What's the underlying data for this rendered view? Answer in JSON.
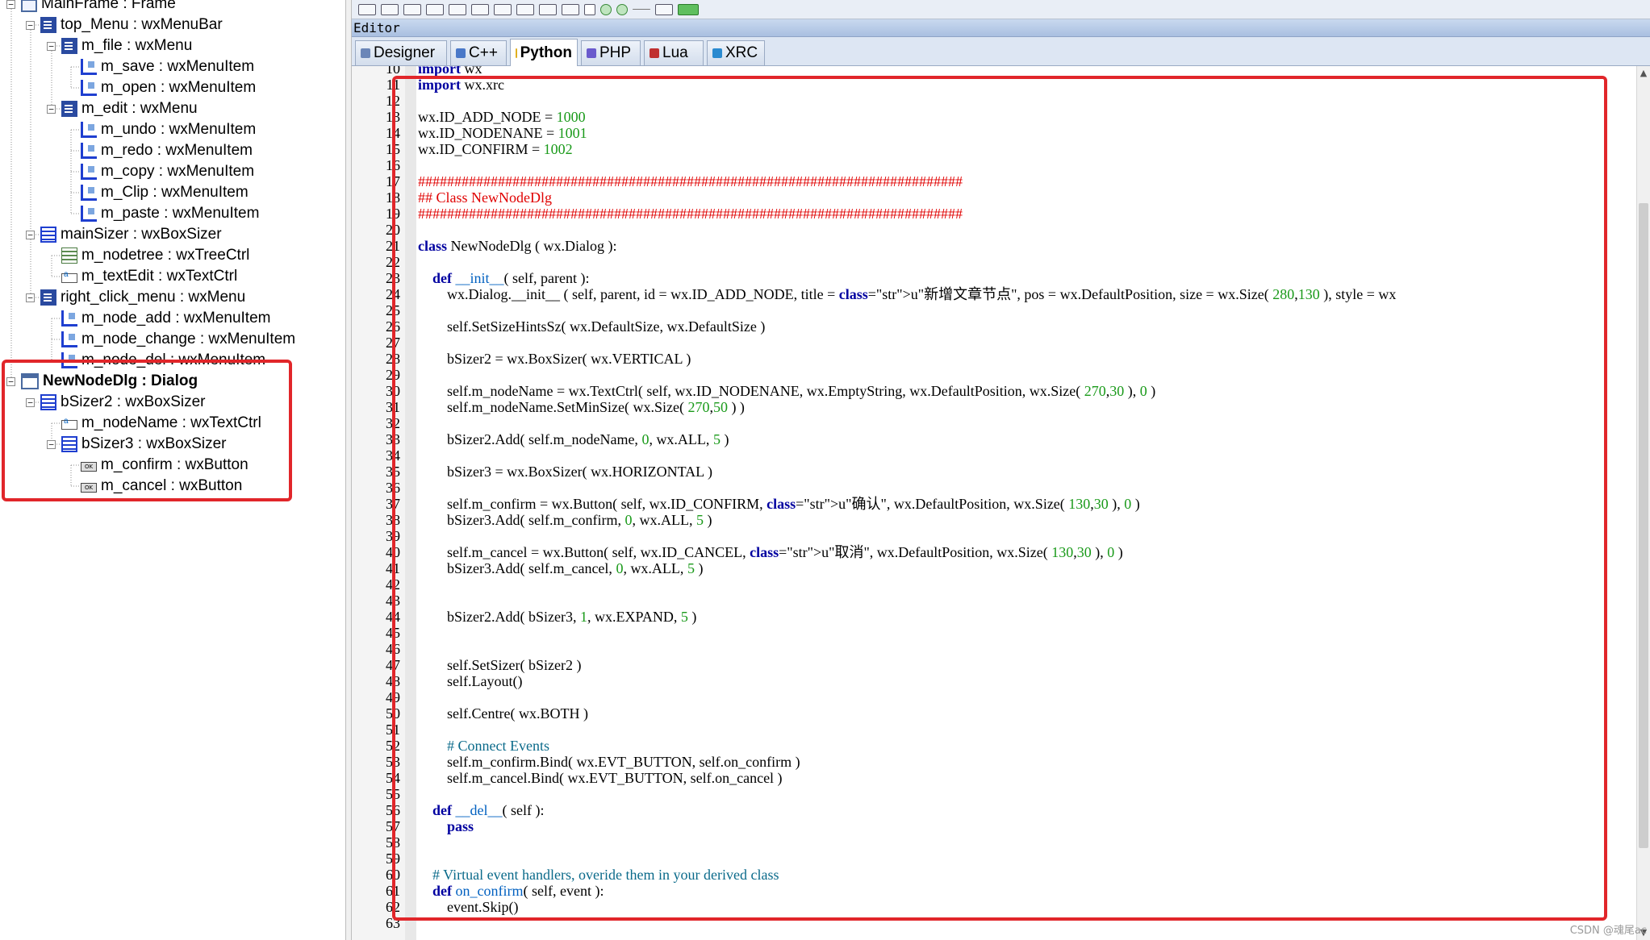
{
  "tree": {
    "items": [
      {
        "label": "MainFrame : Frame",
        "icon": "frame-icon"
      },
      {
        "label": "top_Menu : wxMenuBar",
        "icon": "menubar-icon"
      },
      {
        "label": "m_file : wxMenu",
        "icon": "menu-icon"
      },
      {
        "label": "m_save : wxMenuItem",
        "icon": "menuitem-icon"
      },
      {
        "label": "m_open : wxMenuItem",
        "icon": "menuitem-icon"
      },
      {
        "label": "m_edit : wxMenu",
        "icon": "menu-icon"
      },
      {
        "label": "m_undo : wxMenuItem",
        "icon": "menuitem-icon"
      },
      {
        "label": "m_redo : wxMenuItem",
        "icon": "menuitem-icon"
      },
      {
        "label": "m_copy : wxMenuItem",
        "icon": "menuitem-icon"
      },
      {
        "label": "m_Clip : wxMenuItem",
        "icon": "menuitem-icon"
      },
      {
        "label": "m_paste : wxMenuItem",
        "icon": "menuitem-icon"
      },
      {
        "label": "mainSizer : wxBoxSizer",
        "icon": "sizer-icon"
      },
      {
        "label": "m_nodetree : wxTreeCtrl",
        "icon": "treectrl-icon"
      },
      {
        "label": "m_textEdit : wxTextCtrl",
        "icon": "textctrl-icon"
      },
      {
        "label": "right_click_menu : wxMenu",
        "icon": "menu-icon"
      },
      {
        "label": "m_node_add : wxMenuItem",
        "icon": "menuitem-icon"
      },
      {
        "label": "m_node_change : wxMenuItem",
        "icon": "menuitem-icon"
      },
      {
        "label": "m_node_del : wxMenuItem",
        "icon": "menuitem-icon"
      },
      {
        "label": "NewNodeDlg : Dialog",
        "icon": "dialog-icon"
      },
      {
        "label": "bSizer2 : wxBoxSizer",
        "icon": "sizer-icon"
      },
      {
        "label": "m_nodeName : wxTextCtrl",
        "icon": "textctrl-icon"
      },
      {
        "label": "bSizer3 : wxBoxSizer",
        "icon": "sizer-icon"
      },
      {
        "label": "m_confirm : wxButton",
        "icon": "button-icon"
      },
      {
        "label": "m_cancel : wxButton",
        "icon": "button-icon"
      }
    ]
  },
  "editor": {
    "title": "Editor",
    "tabs": [
      {
        "label": "Designer",
        "icon": "designer-icon",
        "active": false
      },
      {
        "label": "C++",
        "icon": "cpp-icon",
        "active": false
      },
      {
        "label": "Python",
        "icon": "python-icon",
        "active": true
      },
      {
        "label": "PHP",
        "icon": "php-icon",
        "active": false
      },
      {
        "label": "Lua",
        "icon": "lua-icon",
        "active": false
      },
      {
        "label": "XRC",
        "icon": "xrc-icon",
        "active": false
      }
    ],
    "code_lines": [
      {
        "n": "10",
        "text": "import wx"
      },
      {
        "n": "11",
        "text": "import wx.xrc"
      },
      {
        "n": "12",
        "text": ""
      },
      {
        "n": "13",
        "text": "wx.ID_ADD_NODE = 1000"
      },
      {
        "n": "14",
        "text": "wx.ID_NODENANE = 1001"
      },
      {
        "n": "15",
        "text": "wx.ID_CONFIRM = 1002"
      },
      {
        "n": "16",
        "text": ""
      },
      {
        "n": "17",
        "text": "###########################################################################"
      },
      {
        "n": "18",
        "text": "## Class NewNodeDlg"
      },
      {
        "n": "19",
        "text": "###########################################################################"
      },
      {
        "n": "20",
        "text": ""
      },
      {
        "n": "21",
        "text": "class NewNodeDlg ( wx.Dialog ):"
      },
      {
        "n": "22",
        "text": ""
      },
      {
        "n": "23",
        "text": "    def __init__( self, parent ):"
      },
      {
        "n": "24",
        "text": "        wx.Dialog.__init__ ( self, parent, id = wx.ID_ADD_NODE, title = u\"新增文章节点\", pos = wx.DefaultPosition, size = wx.Size( 280,130 ), style = wx"
      },
      {
        "n": "25",
        "text": ""
      },
      {
        "n": "26",
        "text": "        self.SetSizeHintsSz( wx.DefaultSize, wx.DefaultSize )"
      },
      {
        "n": "27",
        "text": ""
      },
      {
        "n": "28",
        "text": "        bSizer2 = wx.BoxSizer( wx.VERTICAL )"
      },
      {
        "n": "29",
        "text": ""
      },
      {
        "n": "30",
        "text": "        self.m_nodeName = wx.TextCtrl( self, wx.ID_NODENANE, wx.EmptyString, wx.DefaultPosition, wx.Size( 270,30 ), 0 )"
      },
      {
        "n": "31",
        "text": "        self.m_nodeName.SetMinSize( wx.Size( 270,50 ) )"
      },
      {
        "n": "32",
        "text": ""
      },
      {
        "n": "33",
        "text": "        bSizer2.Add( self.m_nodeName, 0, wx.ALL, 5 )"
      },
      {
        "n": "34",
        "text": ""
      },
      {
        "n": "35",
        "text": "        bSizer3 = wx.BoxSizer( wx.HORIZONTAL )"
      },
      {
        "n": "36",
        "text": ""
      },
      {
        "n": "37",
        "text": "        self.m_confirm = wx.Button( self, wx.ID_CONFIRM, u\"确认\", wx.DefaultPosition, wx.Size( 130,30 ), 0 )"
      },
      {
        "n": "38",
        "text": "        bSizer3.Add( self.m_confirm, 0, wx.ALL, 5 )"
      },
      {
        "n": "39",
        "text": ""
      },
      {
        "n": "40",
        "text": "        self.m_cancel = wx.Button( self, wx.ID_CANCEL, u\"取消\", wx.DefaultPosition, wx.Size( 130,30 ), 0 )"
      },
      {
        "n": "41",
        "text": "        bSizer3.Add( self.m_cancel, 0, wx.ALL, 5 )"
      },
      {
        "n": "42",
        "text": ""
      },
      {
        "n": "43",
        "text": ""
      },
      {
        "n": "44",
        "text": "        bSizer2.Add( bSizer3, 1, wx.EXPAND, 5 )"
      },
      {
        "n": "45",
        "text": ""
      },
      {
        "n": "46",
        "text": ""
      },
      {
        "n": "47",
        "text": "        self.SetSizer( bSizer2 )"
      },
      {
        "n": "48",
        "text": "        self.Layout()"
      },
      {
        "n": "49",
        "text": ""
      },
      {
        "n": "50",
        "text": "        self.Centre( wx.BOTH )"
      },
      {
        "n": "51",
        "text": ""
      },
      {
        "n": "52",
        "text": "        # Connect Events"
      },
      {
        "n": "53",
        "text": "        self.m_confirm.Bind( wx.EVT_BUTTON, self.on_confirm )"
      },
      {
        "n": "54",
        "text": "        self.m_cancel.Bind( wx.EVT_BUTTON, self.on_cancel )"
      },
      {
        "n": "55",
        "text": ""
      },
      {
        "n": "56",
        "text": "    def __del__( self ):"
      },
      {
        "n": "57",
        "text": "        pass"
      },
      {
        "n": "58",
        "text": ""
      },
      {
        "n": "59",
        "text": ""
      },
      {
        "n": "60",
        "text": "    # Virtual event handlers, overide them in your derived class"
      },
      {
        "n": "61",
        "text": "    def on_confirm( self, event ):"
      },
      {
        "n": "62",
        "text": "        event.Skip()"
      },
      {
        "n": "63",
        "text": ""
      }
    ]
  },
  "watermark": "CSDN @魂尾ac",
  "colors": {
    "highlight_box": "#e1262a",
    "keyword": "#0000a0",
    "number": "#1a9a1a",
    "banner_comment": "#e00000",
    "comment": "#0a6a8a"
  }
}
